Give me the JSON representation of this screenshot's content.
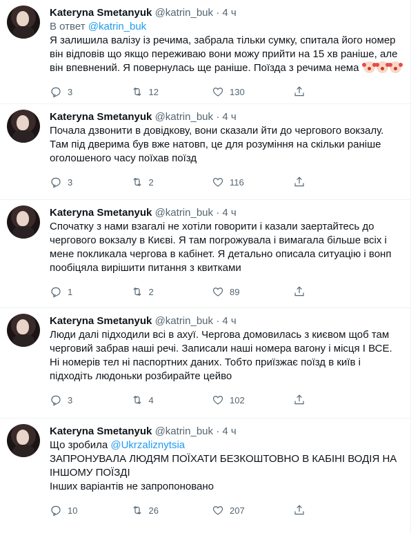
{
  "tweets": [
    {
      "name": "Kateryna Smetanyuk",
      "handle": "@katrin_buk",
      "dot": "·",
      "time": "4 ч",
      "reply_prefix": "В ответ ",
      "reply_to": "@katrin_buk",
      "text": "Я залишила валізу із речима, забрала тільки сумку, спитала його номер він відповів що якщо переживаю вони можу прийти на 15 хв раніше, але він впевнений. Я повернулась ще раніше. Поїзда з речима нема",
      "emoji": [
        "clown-face-emoji",
        "clown-face-emoji",
        "clown-face-emoji"
      ],
      "replies": "3",
      "retweets": "12",
      "likes": "130"
    },
    {
      "name": "Kateryna Smetanyuk",
      "handle": "@katrin_buk",
      "dot": "·",
      "time": "4 ч",
      "text": "Почала дзвонити в довідкову, вони сказали йти до чергового вокзалу. Там під дверима був вже натовп, це для розуміння на скільки раніше оголошеного часу поїхав поїзд",
      "replies": "3",
      "retweets": "2",
      "likes": "116"
    },
    {
      "name": "Kateryna Smetanyuk",
      "handle": "@katrin_buk",
      "dot": "·",
      "time": "4 ч",
      "text": "Спочатку з нами взагалі не хотіли говорити і казали заертайтесь до чергового вокзалу в Києві. Я там погрожувала і вимагала більше всіх і мене покликала чергова в кабінет. Я детально описала ситуацію і вонп пообіцяла вирішити питання з квитками",
      "replies": "1",
      "retweets": "2",
      "likes": "89"
    },
    {
      "name": "Kateryna Smetanyuk",
      "handle": "@katrin_buk",
      "dot": "·",
      "time": "4 ч",
      "text": "Люди далі підходили всі в ахуї. Чергова домовилась з києвом щоб там черговий забрав наші речі. Записали наші номера вагону і місця І ВСЕ. Ні номерів тел ні паспортних даних. Тобто приїзжає поїзд в київ і підходіть людоньки розбирайте цейво",
      "replies": "3",
      "retweets": "4",
      "likes": "102"
    },
    {
      "name": "Kateryna Smetanyuk",
      "handle": "@katrin_buk",
      "dot": "·",
      "time": "4 ч",
      "text_before_mention": "Що зробила ",
      "mention": "@Ukrzaliznytsia",
      "text_after_mention": "\nЗАПРОНУВАЛА ЛЮДЯМ ПОЇХАТИ БЕЗКОШТОВНО В КАБІНІ ВОДІЯ НА ІНШОМУ ПОЇЗДІ\nІнших варіантів не запропоновано",
      "replies": "10",
      "retweets": "26",
      "likes": "207"
    }
  ],
  "icons": {
    "reply": "reply-icon",
    "retweet": "retweet-icon",
    "like": "heart-icon",
    "share": "share-icon",
    "more": "more-icon"
  },
  "colors": {
    "link": "#1d9bf0",
    "secondary": "#536471",
    "text": "#0f1419"
  }
}
